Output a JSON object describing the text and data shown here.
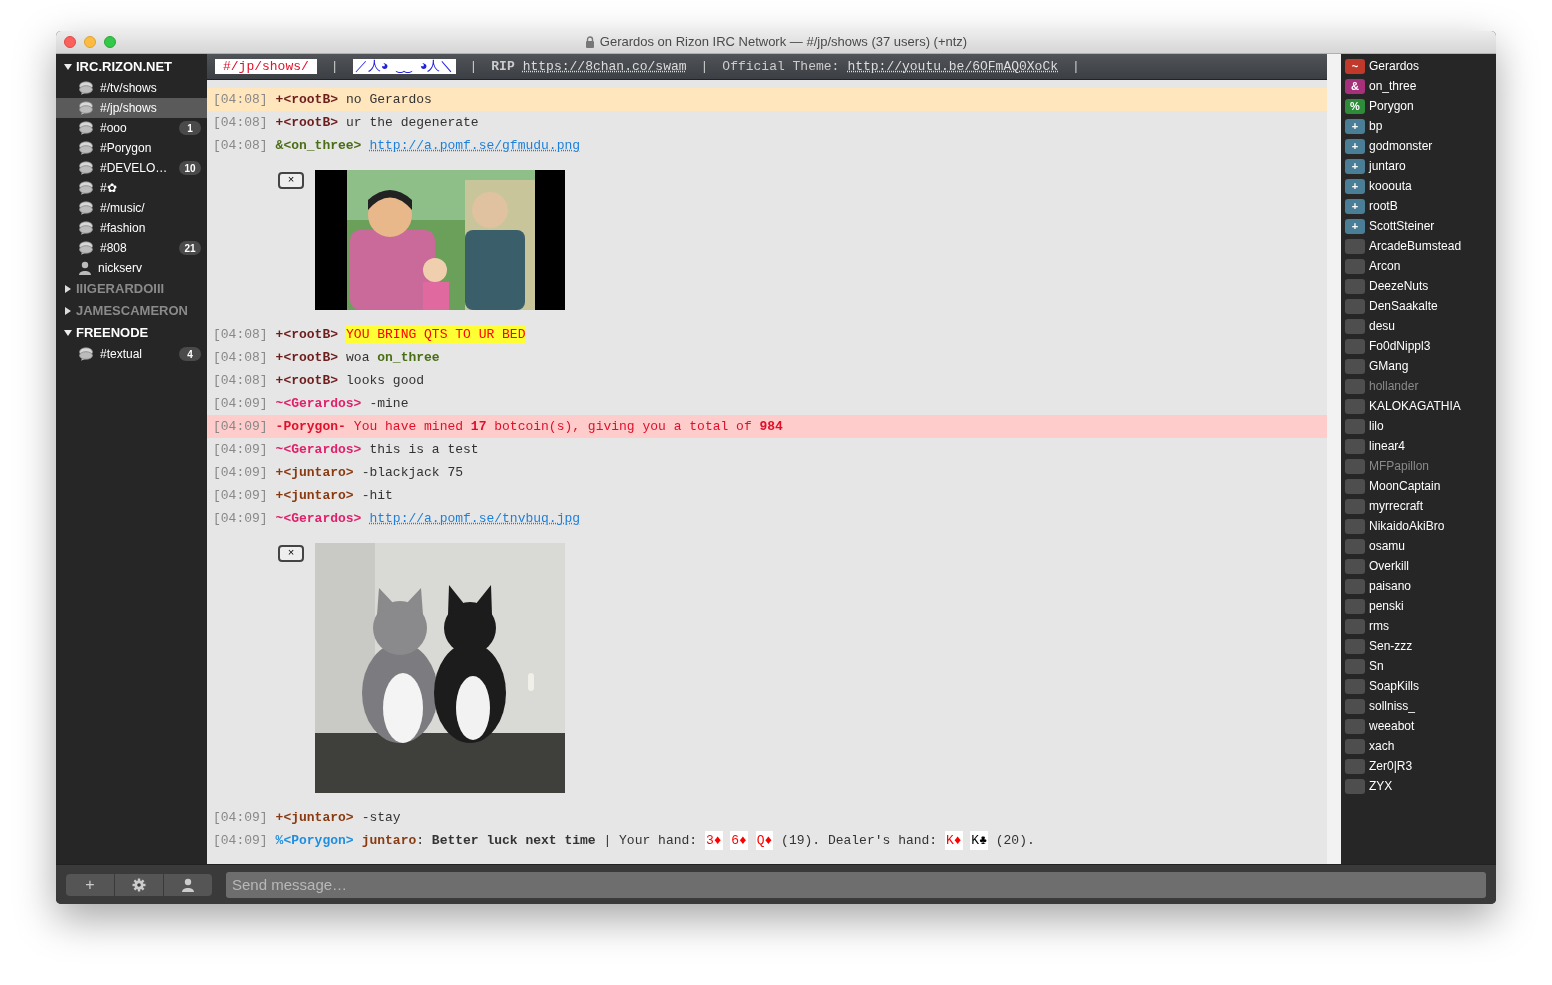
{
  "window": {
    "title": "Gerardos on Rizon IRC Network — #/jp/shows (37 users) (+ntz)"
  },
  "servers": [
    {
      "name": "IRC.RIZON.NET",
      "expanded": true,
      "connected": true,
      "channels": [
        {
          "name": "#/tv/shows",
          "kind": "channel",
          "selected": false
        },
        {
          "name": "#/jp/shows",
          "kind": "channel",
          "selected": true
        },
        {
          "name": "#ooo",
          "kind": "channel",
          "selected": false,
          "badge": "1"
        },
        {
          "name": "#Porygon",
          "kind": "channel",
          "selected": false
        },
        {
          "name": "#DEVELO…",
          "kind": "channel",
          "selected": false,
          "badge": "10"
        },
        {
          "name": "#✿",
          "kind": "channel",
          "selected": false
        },
        {
          "name": "#/music/",
          "kind": "channel",
          "selected": false
        },
        {
          "name": "#fashion",
          "kind": "channel",
          "selected": false
        },
        {
          "name": "#808",
          "kind": "channel",
          "selected": false,
          "badge": "21"
        },
        {
          "name": "nickserv",
          "kind": "query",
          "selected": false
        }
      ]
    },
    {
      "name": "IIIGERARDOIII",
      "expanded": false,
      "connected": false
    },
    {
      "name": "JAMESCAMERON",
      "expanded": false,
      "connected": false
    },
    {
      "name": "FREENODE",
      "expanded": true,
      "connected": true,
      "channels": [
        {
          "name": "#textual",
          "kind": "channel",
          "selected": false,
          "badge": "4"
        }
      ]
    }
  ],
  "topic": [
    {
      "kind": "channel",
      "text": "#/jp/shows/"
    },
    {
      "kind": "sep",
      "text": "|"
    },
    {
      "kind": "emote",
      "text": "／人◕ ‿‿ ◕人＼"
    },
    {
      "kind": "sep",
      "text": "|"
    },
    {
      "kind": "bold",
      "text": "RIP"
    },
    {
      "kind": "link",
      "text": "https://8chan.co/swam"
    },
    {
      "kind": "sep",
      "text": "|"
    },
    {
      "kind": "text",
      "text": "Official Theme:"
    },
    {
      "kind": "link",
      "text": "http://youtu.be/6OFmAQ0XoCk"
    },
    {
      "kind": "sep",
      "text": "|"
    }
  ],
  "messages": [
    {
      "kind": "line",
      "time": "[04:08]",
      "nick": "+<rootB>",
      "color": "#6e1d1d",
      "mention": true,
      "notice": false,
      "body": [
        {
          "kind": "text",
          "text": "no Gerardos"
        }
      ]
    },
    {
      "kind": "line",
      "time": "[04:08]",
      "nick": "+<rootB>",
      "color": "#6e1d1d",
      "mention": false,
      "notice": false,
      "body": [
        {
          "kind": "text",
          "text": "ur the degenerate"
        }
      ]
    },
    {
      "kind": "line",
      "time": "[04:08]",
      "nick": "&<on_three>",
      "color": "#4a6e16",
      "mention": false,
      "notice": false,
      "body": [
        {
          "kind": "link",
          "text": "http://a.pomf.se/gfmudu.png"
        }
      ]
    },
    {
      "close": "×"
    },
    {
      "kind": "line",
      "time": "[04:08]",
      "nick": "+<rootB>",
      "color": "#6e1d1d",
      "mention": false,
      "notice": false,
      "body": [
        {
          "kind": "shout",
          "text": "YOU BRING QTS TO UR BED"
        }
      ]
    },
    {
      "kind": "line",
      "time": "[04:08]",
      "nick": "+<rootB>",
      "color": "#6e1d1d",
      "mention": false,
      "notice": false,
      "body": [
        {
          "kind": "text",
          "text": "woa"
        },
        {
          "kind": "mention",
          "text": "on_three",
          "color": "#4a6e16"
        }
      ]
    },
    {
      "kind": "line",
      "time": "[04:08]",
      "nick": "+<rootB>",
      "color": "#6e1d1d",
      "mention": false,
      "notice": false,
      "body": [
        {
          "kind": "text",
          "text": "looks good"
        }
      ]
    },
    {
      "kind": "line",
      "time": "[04:09]",
      "nick": "~<Gerardos>",
      "color": "#e0206a",
      "mention": false,
      "notice": false,
      "body": [
        {
          "kind": "text",
          "text": "-mine"
        }
      ]
    },
    {
      "kind": "line",
      "time": "[04:09]",
      "nick": "-Porygon-",
      "color": "#e0102a",
      "mention": false,
      "notice": true,
      "body": [
        {
          "kind": "text",
          "text": "You have mined"
        },
        {
          "kind": "bold",
          "text": "17"
        },
        {
          "kind": "text",
          "text": "botcoin(s), giving you a total of"
        },
        {
          "kind": "bold",
          "text": "984"
        }
      ]
    },
    {
      "kind": "line",
      "time": "[04:09]",
      "nick": "~<Gerardos>",
      "color": "#e0206a",
      "mention": false,
      "notice": false,
      "body": [
        {
          "kind": "text",
          "text": "this is a test"
        }
      ]
    },
    {
      "kind": "line",
      "time": "[04:09]",
      "nick": "+<juntaro>",
      "color": "#8a3a10",
      "mention": false,
      "notice": false,
      "body": [
        {
          "kind": "text",
          "text": "-blackjack 75"
        }
      ]
    },
    {
      "kind": "line",
      "time": "[04:09]",
      "nick": "+<juntaro>",
      "color": "#8a3a10",
      "mention": false,
      "notice": false,
      "body": [
        {
          "kind": "text",
          "text": "-hit"
        }
      ]
    },
    {
      "kind": "line",
      "time": "[04:09]",
      "nick": "~<Gerardos>",
      "color": "#e0206a",
      "mention": false,
      "notice": false,
      "body": [
        {
          "kind": "link",
          "text": "http://a.pomf.se/tnvbuq.jpg"
        }
      ]
    },
    {
      "close": "×"
    },
    {
      "kind": "line",
      "time": "[04:09]",
      "nick": "+<juntaro>",
      "color": "#8a3a10",
      "mention": false,
      "notice": false,
      "body": [
        {
          "kind": "text",
          "text": "-stay"
        }
      ]
    },
    {
      "kind": "line",
      "time": "[04:09]",
      "nick": "%<Porygon>",
      "color": "#1e8ee0",
      "mention": false,
      "notice": false,
      "body": [
        {
          "kind": "mention",
          "text": "juntaro",
          "color": "#8a3a10"
        },
        {
          "kind": "tight",
          "text": ":"
        },
        {
          "kind": "bold",
          "text": "Better luck next time"
        },
        {
          "kind": "text",
          "text": "| Your hand:"
        },
        {
          "kind": "card",
          "text": "3♦",
          "color": "#ff0000"
        },
        {
          "kind": "card",
          "text": "6♦",
          "color": "#ff0000"
        },
        {
          "kind": "card",
          "text": "Q♦",
          "color": "#ff0000"
        },
        {
          "kind": "text",
          "text": "(19). Dealer's hand:"
        },
        {
          "kind": "card",
          "text": "K♦",
          "color": "#ff0000"
        },
        {
          "kind": "card",
          "text": "K♣",
          "color": "#000000"
        },
        {
          "kind": "text",
          "text": "(20)."
        }
      ]
    }
  ],
  "users": [
    {
      "mode": "~",
      "name": "Gerardos",
      "color": "#c0392b",
      "away": false
    },
    {
      "mode": "&",
      "name": "on_three",
      "color": "#a6317a",
      "away": false
    },
    {
      "mode": "%",
      "name": "Porygon",
      "color": "#2e8b3a",
      "away": false
    },
    {
      "mode": "+",
      "name": "bp",
      "color": "#4a7d96",
      "away": false
    },
    {
      "mode": "+",
      "name": "godmonster",
      "color": "#4a7d96",
      "away": false
    },
    {
      "mode": "+",
      "name": "juntaro",
      "color": "#4a7d96",
      "away": false
    },
    {
      "mode": "+",
      "name": "kooouta",
      "color": "#4a7d96",
      "away": false
    },
    {
      "mode": "+",
      "name": "rootB",
      "color": "#4a7d96",
      "away": false
    },
    {
      "mode": "+",
      "name": "ScottSteiner",
      "color": "#4a7d96",
      "away": false
    },
    {
      "name": "ArcadeBumstead",
      "away": false
    },
    {
      "name": "Arcon",
      "away": false
    },
    {
      "name": "DeezeNuts",
      "away": false
    },
    {
      "name": "DenSaakalte",
      "away": false
    },
    {
      "name": "desu",
      "away": false
    },
    {
      "name": "Fo0dNippl3",
      "away": false
    },
    {
      "name": "GMang",
      "away": false
    },
    {
      "name": "hollander",
      "away": true
    },
    {
      "name": "KALOKAGATHIA",
      "away": false
    },
    {
      "name": "lilo",
      "away": false
    },
    {
      "name": "linear4",
      "away": false
    },
    {
      "name": "MFPapillon",
      "away": true
    },
    {
      "name": "MoonCaptain",
      "away": false
    },
    {
      "name": "myrrecraft",
      "away": false
    },
    {
      "name": "NikaidoAkiBro",
      "away": false
    },
    {
      "name": "osamu",
      "away": false
    },
    {
      "name": "Overkill",
      "away": false
    },
    {
      "name": "paisano",
      "away": false
    },
    {
      "name": "penski",
      "away": false
    },
    {
      "name": "rms",
      "away": false
    },
    {
      "name": "Sen-zzz",
      "away": false
    },
    {
      "name": "Sn",
      "away": false
    },
    {
      "name": "SoapKills",
      "away": false
    },
    {
      "name": "sollniss_",
      "away": false
    },
    {
      "name": "weeabot",
      "away": false
    },
    {
      "name": "xach",
      "away": false
    },
    {
      "name": "Zer0|R3",
      "away": false
    },
    {
      "name": "ZYX",
      "away": false
    }
  ],
  "bottom_bar": {
    "add_label": "+",
    "input": {
      "placeholder": "Send message…"
    }
  }
}
